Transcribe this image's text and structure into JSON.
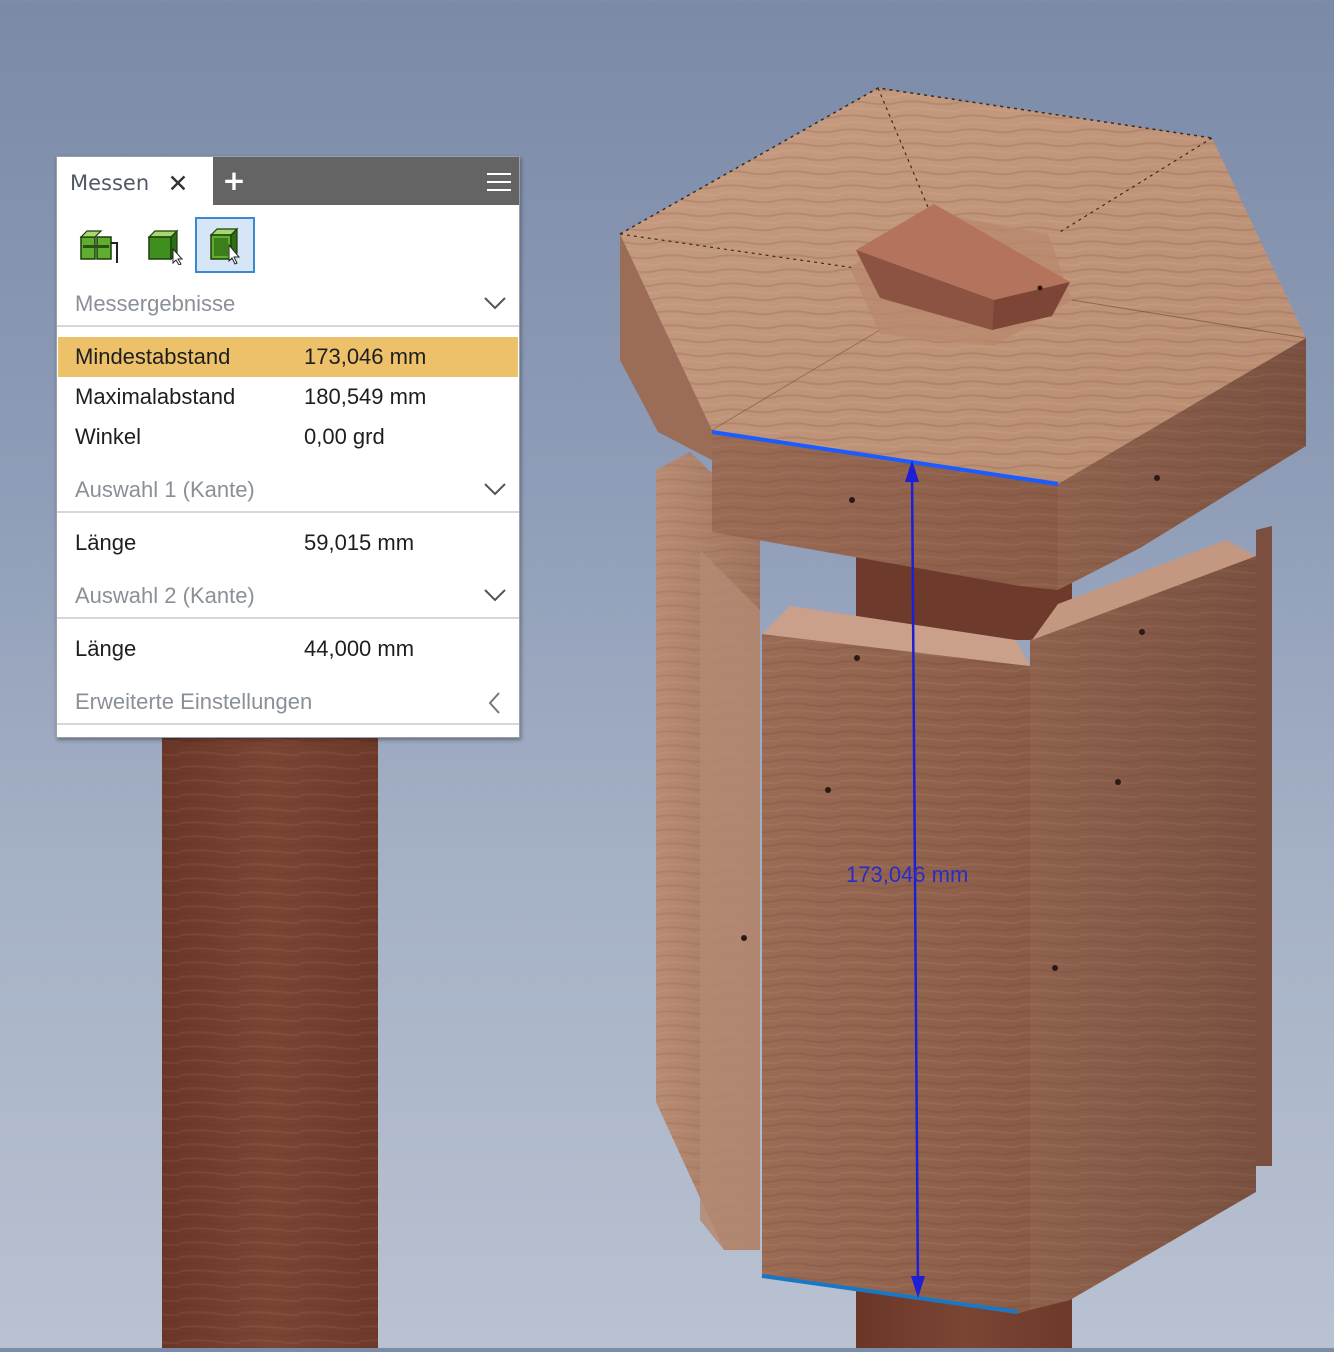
{
  "panel": {
    "tab_label": "Messen",
    "close_glyph": "✕",
    "add_glyph": "+",
    "tools": [
      {
        "name": "measure-distance-tool",
        "icon": "distance-measure-icon",
        "active": false
      },
      {
        "name": "measure-region-tool",
        "icon": "region-measure-icon",
        "active": false
      },
      {
        "name": "measure-select-tool",
        "icon": "select-measure-icon",
        "active": true
      }
    ],
    "results": {
      "title": "Messergebnisse",
      "rows": [
        {
          "label": "Mindestabstand",
          "value": "173,046 mm"
        },
        {
          "label": "Maximalabstand",
          "value": "180,549 mm"
        },
        {
          "label": "Winkel",
          "value": "0,00 grd"
        }
      ]
    },
    "selection1": {
      "title": "Auswahl 1 (Kante)",
      "label": "Länge",
      "value": "59,015 mm"
    },
    "selection2": {
      "title": "Auswahl 2 (Kante)",
      "label": "Länge",
      "value": "44,000 mm"
    },
    "advanced": {
      "title": "Erweiterte Einstellungen"
    }
  },
  "viewport": {
    "dimension_label": "173,046 mm",
    "dimension_color": "#1d1fd6",
    "edge_highlight_color": "#1a5cff",
    "wood_color": "#a0705a"
  }
}
